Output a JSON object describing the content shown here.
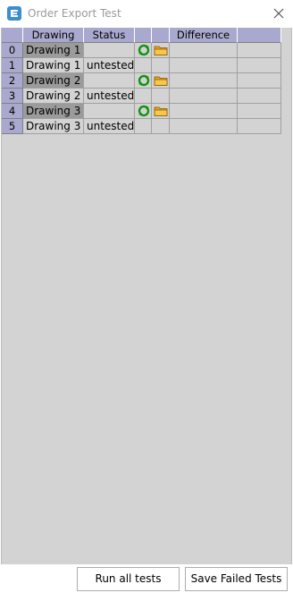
{
  "window": {
    "title": "Order Export Test",
    "app_icon": "app-logo-icon",
    "close_icon": "close-icon"
  },
  "grid": {
    "columns": [
      "",
      "Drawing",
      "Status",
      "",
      "",
      "Difference",
      ""
    ],
    "rows": [
      {
        "index": "0",
        "drawing": "Drawing 1",
        "status": "",
        "selected": true,
        "has_actions": true
      },
      {
        "index": "1",
        "drawing": "Drawing 1",
        "status": "untested",
        "selected": false,
        "has_actions": false
      },
      {
        "index": "2",
        "drawing": "Drawing 2",
        "status": "",
        "selected": true,
        "has_actions": true
      },
      {
        "index": "3",
        "drawing": "Drawing 2",
        "status": "untested",
        "selected": false,
        "has_actions": false
      },
      {
        "index": "4",
        "drawing": "Drawing 3",
        "status": "",
        "selected": true,
        "has_actions": true
      },
      {
        "index": "5",
        "drawing": "Drawing 3",
        "status": "untested",
        "selected": false,
        "has_actions": false
      }
    ],
    "row_icons": {
      "refresh": "refresh-icon",
      "folder": "open-folder-icon"
    }
  },
  "buttons": {
    "run_all": "Run all tests",
    "save_failed": "Save Failed Tests"
  },
  "colors": {
    "header_bg": "#a9a9cf",
    "selected_cell": "#9b9b9b",
    "grid_bg": "#d3d3d3"
  }
}
